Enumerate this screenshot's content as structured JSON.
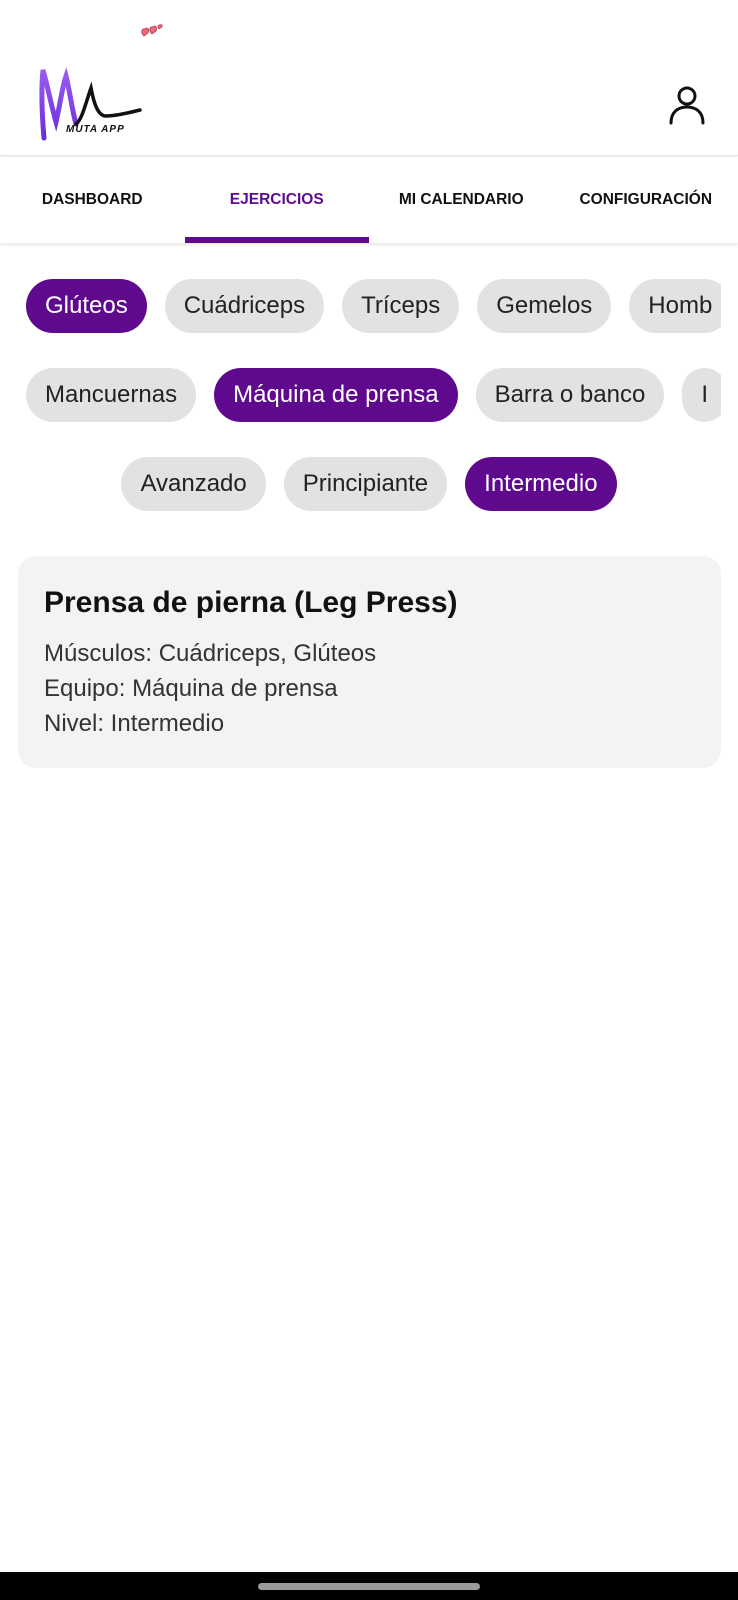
{
  "header": {
    "logo_text": "MUTA APP",
    "profile_icon": "user-icon"
  },
  "tabs": [
    {
      "label": "DASHBOARD",
      "active": false
    },
    {
      "label": "EJERCICIOS",
      "active": true
    },
    {
      "label": "MI CALENDARIO",
      "active": false
    },
    {
      "label": "CONFIGURACIÓN",
      "active": false
    }
  ],
  "filters": {
    "muscles": [
      {
        "label": "Glúteos",
        "selected": true
      },
      {
        "label": "Cuádriceps",
        "selected": false
      },
      {
        "label": "Tríceps",
        "selected": false
      },
      {
        "label": "Gemelos",
        "selected": false
      },
      {
        "label": "Homb",
        "selected": false
      }
    ],
    "equipment": [
      {
        "label": "Mancuernas",
        "selected": false
      },
      {
        "label": "Máquina de prensa",
        "selected": true
      },
      {
        "label": "Barra o banco",
        "selected": false
      },
      {
        "label": "I",
        "selected": false
      }
    ],
    "levels": [
      {
        "label": "Avanzado",
        "selected": false
      },
      {
        "label": "Principiante",
        "selected": false
      },
      {
        "label": "Intermedio",
        "selected": true
      }
    ]
  },
  "exercise": {
    "title": "Prensa de pierna (Leg Press)",
    "muscles": "Músculos: Cuádriceps, Glúteos",
    "equipment": "Equipo: Máquina de prensa",
    "level": "Nivel: Intermedio"
  },
  "colors": {
    "accent": "#5f0a8e",
    "chip_bg": "#e2e2e2",
    "card_bg": "#f3f3f3"
  }
}
